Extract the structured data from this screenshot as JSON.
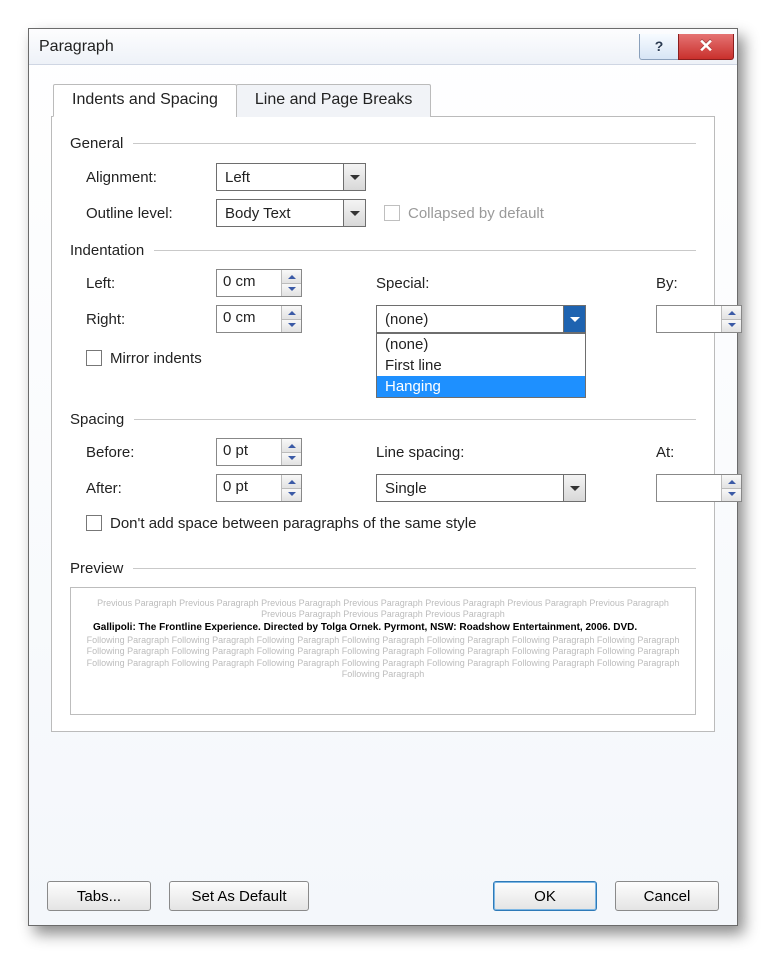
{
  "title": "Paragraph",
  "tabs": {
    "indents": "Indents and Spacing",
    "breaks": "Line and Page Breaks"
  },
  "general": {
    "head": "General",
    "alignment_label": "Alignment:",
    "alignment_value": "Left",
    "outline_label": "Outline level:",
    "outline_value": "Body Text",
    "collapsed_label": "Collapsed by default"
  },
  "indent": {
    "head": "Indentation",
    "left_label": "Left:",
    "left_value": "0 cm",
    "right_label": "Right:",
    "right_value": "0 cm",
    "special_label": "Special:",
    "special_value": "(none)",
    "special_options": [
      "(none)",
      "First line",
      "Hanging"
    ],
    "by_label": "By:",
    "by_value": "",
    "mirror_label": "Mirror indents"
  },
  "spacing": {
    "head": "Spacing",
    "before_label": "Before:",
    "before_value": "0 pt",
    "after_label": "After:",
    "after_value": "0 pt",
    "line_label": "Line spacing:",
    "line_value": "Single",
    "at_label": "At:",
    "at_value": "",
    "noaddspace_label": "Don't add space between paragraphs of the same style"
  },
  "preview": {
    "head": "Preview",
    "prev_line": "Previous Paragraph Previous Paragraph Previous Paragraph Previous Paragraph Previous Paragraph Previous Paragraph Previous Paragraph Previous Paragraph Previous Paragraph Previous Paragraph",
    "sample": "Gallipoli: The Frontline Experience. Directed by Tolga Ornek. Pyrmont, NSW: Roadshow Entertainment, 2006. DVD.",
    "foll_line": "Following Paragraph Following Paragraph Following Paragraph Following Paragraph Following Paragraph Following Paragraph Following Paragraph Following Paragraph Following Paragraph Following Paragraph Following Paragraph Following Paragraph Following Paragraph Following Paragraph Following Paragraph Following Paragraph Following Paragraph Following Paragraph Following Paragraph Following Paragraph Following Paragraph Following Paragraph"
  },
  "buttons": {
    "tabs": "Tabs...",
    "default": "Set As Default",
    "ok": "OK",
    "cancel": "Cancel"
  }
}
